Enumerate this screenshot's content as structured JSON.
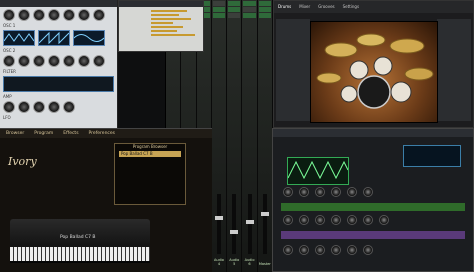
{
  "synth_window": {
    "title": "",
    "labels": [
      "OSC 1",
      "OSC 2",
      "FILTER",
      "AMP",
      "LFO"
    ]
  },
  "eq_dialog": {
    "title": "",
    "items": [
      "",
      "",
      "",
      "",
      "",
      ""
    ]
  },
  "mixer": {
    "channels": [
      "Audio 1",
      "Audio 2",
      "Audio 3",
      "Audio 4",
      "Audio 5",
      "Audio 6",
      "Master"
    ]
  },
  "drum_window": {
    "tabs": [
      "Drums",
      "Mixer",
      "Grooves",
      "Settings"
    ]
  },
  "piano_window": {
    "nav": [
      "Browser",
      "Program",
      "Effects",
      "Preferences"
    ],
    "logo_text": "Ivory",
    "browser_header": "Program Browser",
    "selected_program": "Pop Ballad C7 B",
    "piano_preset_label": "Pop Ballad C7 B"
  },
  "analog_synth_window": {
    "title": "",
    "section_green": "",
    "section_purple": ""
  },
  "colors": {
    "mixer_green": "#2f6a3a",
    "piano_gold": "#c7a454",
    "synth_blue": "#3b7ea8"
  }
}
